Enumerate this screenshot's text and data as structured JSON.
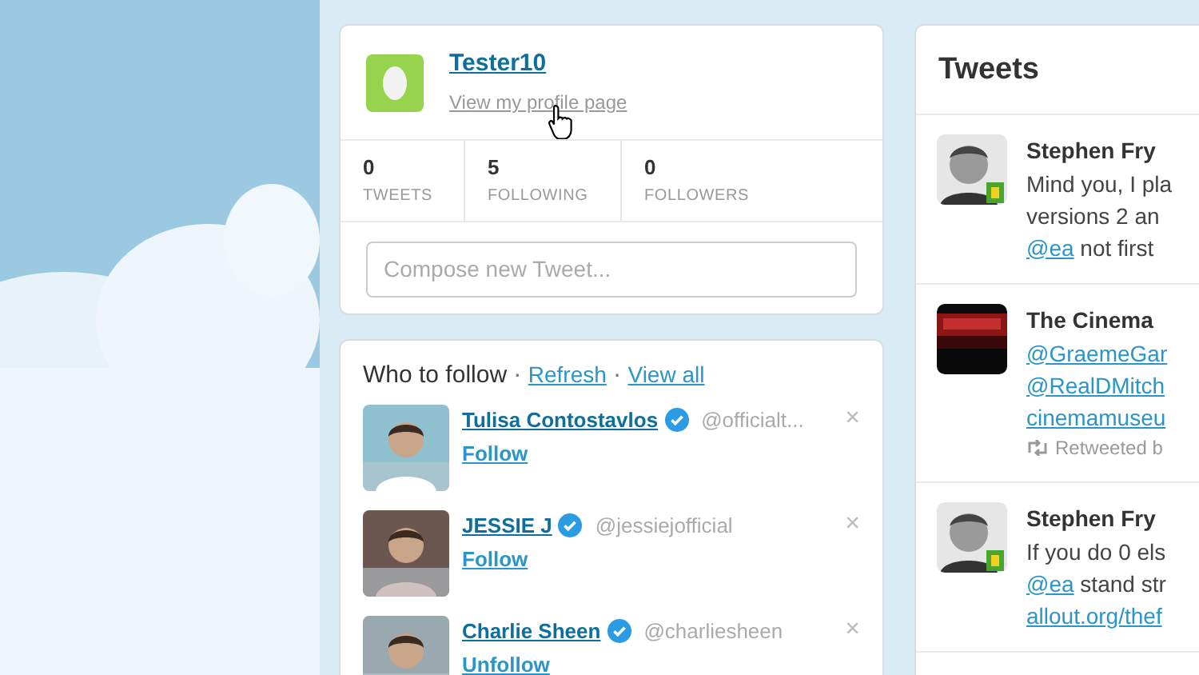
{
  "profile": {
    "name": "Tester10",
    "link": "View my profile page"
  },
  "stats": [
    {
      "value": "0",
      "label": "TWEETS"
    },
    {
      "value": "5",
      "label": "FOLLOWING"
    },
    {
      "value": "0",
      "label": "FOLLOWERS"
    }
  ],
  "compose": {
    "placeholder": "Compose new Tweet..."
  },
  "who_to_follow": {
    "title": "Who to follow",
    "separator": "·",
    "links": [
      "Refresh",
      "View all"
    ],
    "users": [
      {
        "name": "Tulisa Contostavlos",
        "verified": true,
        "handle": "@officialt...",
        "action": "Follow",
        "dismiss": "×"
      },
      {
        "name": "JESSIE J",
        "verified": true,
        "handle": "@jessiejofficial",
        "action": "Follow",
        "dismiss": "×"
      },
      {
        "name": "Charlie Sheen",
        "verified": true,
        "handle": "@charliesheen",
        "action": "Unfollow",
        "dismiss": "×"
      }
    ]
  },
  "tweets": {
    "title": "Tweets",
    "items": [
      {
        "author": "Stephen Fry",
        "lines": [
          [
            {
              "kind": "text",
              "text": "Mind you, I pla"
            }
          ],
          [
            {
              "kind": "text",
              "text": "versions 2 an"
            }
          ],
          [
            {
              "kind": "mention",
              "text": "@ea"
            },
            {
              "kind": "text",
              "text": " not first"
            }
          ]
        ]
      },
      {
        "author": "The Cinema",
        "lines": [
          [
            {
              "kind": "mention",
              "text": "@GraemeGar"
            }
          ],
          [
            {
              "kind": "mention",
              "text": "@RealDMitch"
            }
          ],
          [
            {
              "kind": "link",
              "text": "cinemamuseu"
            }
          ]
        ],
        "retweeted": "Retweeted b"
      },
      {
        "author": "Stephen Fry",
        "lines": [
          [
            {
              "kind": "text",
              "text": "If you do 0 els"
            }
          ],
          [
            {
              "kind": "mention",
              "text": "@ea"
            },
            {
              "kind": "text",
              "text": " stand str"
            }
          ],
          [
            {
              "kind": "link",
              "text": "allout.org/thef"
            }
          ]
        ]
      }
    ]
  }
}
